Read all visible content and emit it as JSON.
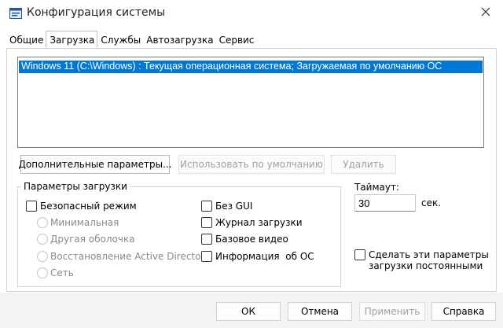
{
  "window": {
    "title": "Конфигурация системы",
    "icon": "msconfig-icon"
  },
  "tabs": [
    {
      "label": "Общие",
      "active": false
    },
    {
      "label": "Загрузка",
      "active": true
    },
    {
      "label": "Службы",
      "active": false
    },
    {
      "label": "Автозагрузка",
      "active": false
    },
    {
      "label": "Сервис",
      "active": false
    }
  ],
  "boot_list": {
    "items": [
      "Windows 11 (C:\\Windows) : Текущая операционная система; Загружаемая по умолчанию ОС"
    ],
    "selected_index": 0
  },
  "list_buttons": {
    "advanced": "Дополнительные параметры...",
    "set_default": "Использовать по умолчанию",
    "delete": "Удалить"
  },
  "boot_options": {
    "legend": "Параметры загрузки",
    "safe_boot": {
      "label": "Безопасный режим",
      "checked": false
    },
    "safe_modes": [
      "Минимальная",
      "Другая оболочка",
      "Восстановление Active Directory",
      "Сеть"
    ],
    "no_gui": {
      "label": "Без GUI",
      "checked": false
    },
    "boot_log": {
      "label": "Журнал загрузки",
      "checked": false
    },
    "base_video": {
      "label": "Базовое видео",
      "checked": false
    },
    "os_info": {
      "label": "Информация  об ОС",
      "checked": false
    }
  },
  "timeout": {
    "label": "Таймаут:",
    "value": "30",
    "unit": "сек."
  },
  "persist": {
    "line1": "Сделать эти параметры",
    "line2": "загрузки постоянными",
    "checked": false
  },
  "footer": {
    "ok": "ОК",
    "cancel": "Отмена",
    "apply": "Применить",
    "help": "Справка"
  },
  "colors": {
    "selection": "#0078d7",
    "footer_bg": "#f3f3f3",
    "disabled_text": "#a0a0a0"
  }
}
